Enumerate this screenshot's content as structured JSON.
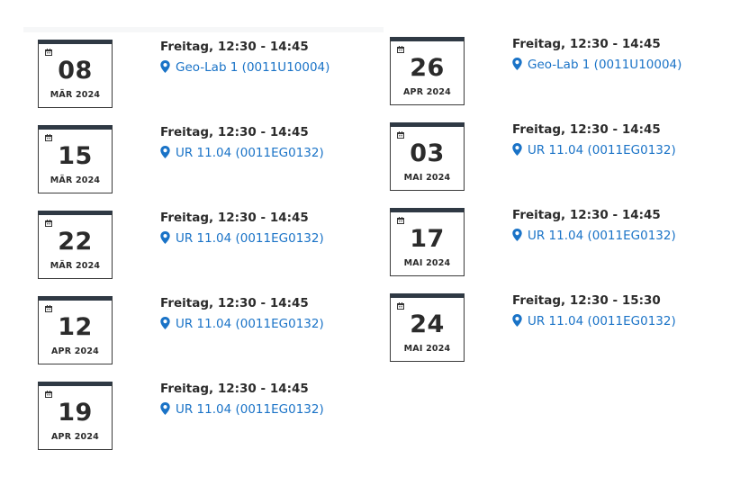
{
  "colors": {
    "accent_link": "#1a73c7",
    "calendar_top_bar": "#2f3944",
    "text": "#2b2b2b"
  },
  "icons": {
    "calendar": "calendar-icon",
    "location": "map-pin-icon"
  },
  "events_left": [
    {
      "day": "08",
      "month": "MÄR 2024",
      "time": "Freitag, 12:30 - 14:45",
      "location": "Geo-Lab 1 (0011U10004)"
    },
    {
      "day": "15",
      "month": "MÄR 2024",
      "time": "Freitag, 12:30 - 14:45",
      "location": "UR 11.04 (0011EG0132)"
    },
    {
      "day": "22",
      "month": "MÄR 2024",
      "time": "Freitag, 12:30 - 14:45",
      "location": "UR 11.04 (0011EG0132)"
    },
    {
      "day": "12",
      "month": "APR 2024",
      "time": "Freitag, 12:30 - 14:45",
      "location": "UR 11.04 (0011EG0132)"
    },
    {
      "day": "19",
      "month": "APR 2024",
      "time": "Freitag, 12:30 - 14:45",
      "location": "UR 11.04 (0011EG0132)"
    }
  ],
  "events_right": [
    {
      "day": "26",
      "month": "APR 2024",
      "time": "Freitag, 12:30 - 14:45",
      "location": "Geo-Lab 1 (0011U10004)"
    },
    {
      "day": "03",
      "month": "MAI 2024",
      "time": "Freitag, 12:30 - 14:45",
      "location": "UR 11.04 (0011EG0132)"
    },
    {
      "day": "17",
      "month": "MAI 2024",
      "time": "Freitag, 12:30 - 14:45",
      "location": "UR 11.04 (0011EG0132)"
    },
    {
      "day": "24",
      "month": "MAI 2024",
      "time": "Freitag, 12:30 - 15:30",
      "location": "UR 11.04 (0011EG0132)"
    }
  ]
}
